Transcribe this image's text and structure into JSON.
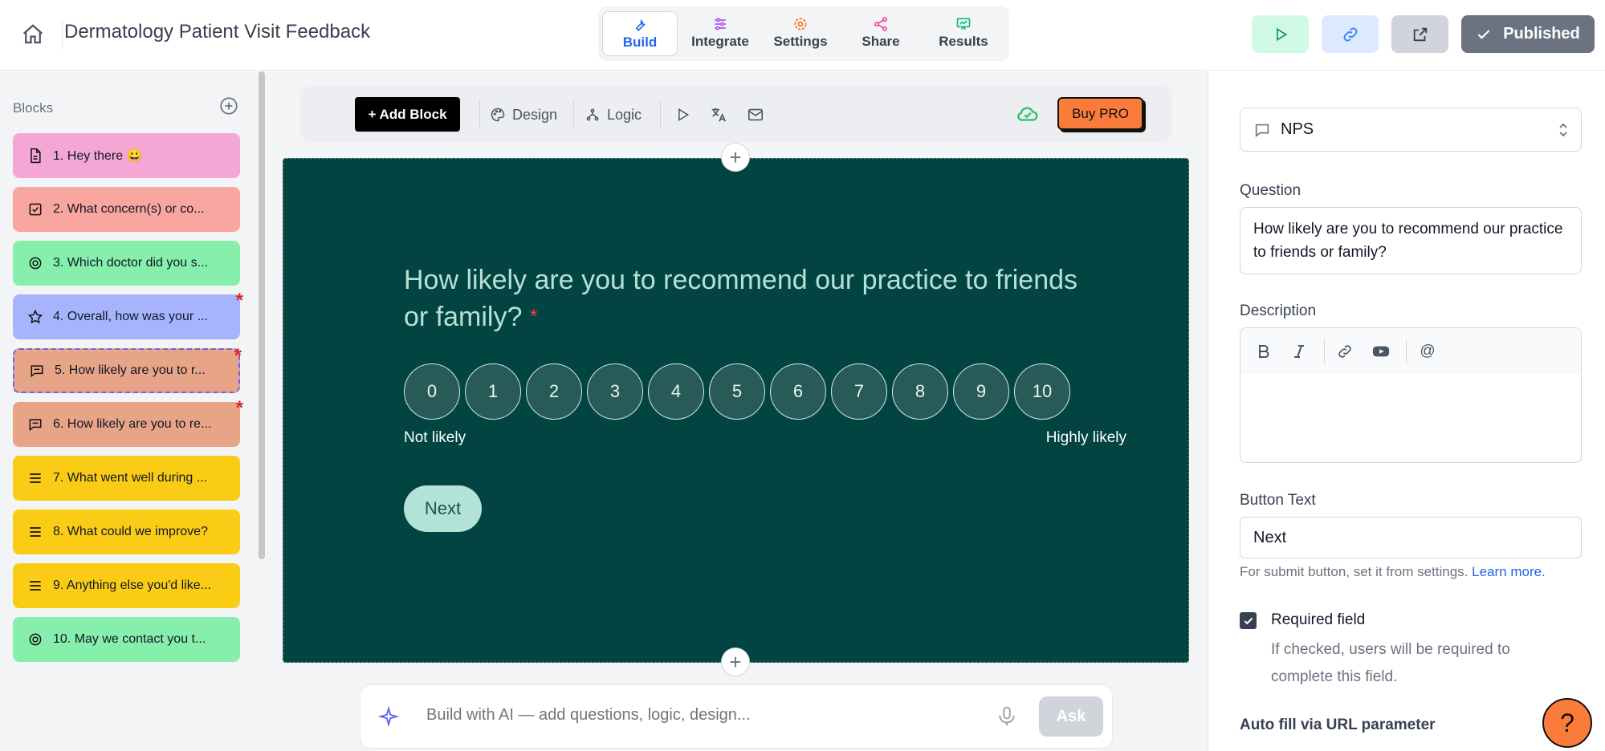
{
  "app": {
    "title": "Dermatology Patient Visit Feedback"
  },
  "tabs": [
    {
      "label": "Build",
      "active": true
    },
    {
      "label": "Integrate",
      "active": false
    },
    {
      "label": "Settings",
      "active": false
    },
    {
      "label": "Share",
      "active": false
    },
    {
      "label": "Results",
      "active": false
    }
  ],
  "topActions": {
    "published_label": "Published"
  },
  "sidebar": {
    "title": "Blocks",
    "blocks": [
      {
        "label": "1. Hey there 😀",
        "color": "#f4a7d4",
        "icon": "document-icon",
        "required": false
      },
      {
        "label": "2. What concern(s) or co...",
        "color": "#f9a5a0",
        "icon": "checkbox-icon",
        "required": false
      },
      {
        "label": "3. Which doctor did you s...",
        "color": "#86efac",
        "icon": "radio-icon",
        "required": false
      },
      {
        "label": "4. Overall, how was your ...",
        "color": "#a5b4fc",
        "icon": "star-icon",
        "required": true
      },
      {
        "label": "5. How likely are you to r...",
        "color": "#e8a487",
        "icon": "chat-icon",
        "required": true,
        "selected": true
      },
      {
        "label": "6. How likely are you to re...",
        "color": "#e8a487",
        "icon": "chat-icon",
        "required": true
      },
      {
        "label": "7. What went well during ...",
        "color": "#facc15",
        "icon": "lines-icon",
        "required": false
      },
      {
        "label": "8. What could we improve?",
        "color": "#facc15",
        "icon": "lines-icon",
        "required": false
      },
      {
        "label": "9. Anything else you'd like...",
        "color": "#facc15",
        "icon": "lines-icon",
        "required": false
      },
      {
        "label": "10. May we contact you t...",
        "color": "#86efac",
        "icon": "radio-icon",
        "required": false
      }
    ]
  },
  "toolbar": {
    "add_block": "+ Add Block",
    "design": "Design",
    "logic": "Logic",
    "buy_pro": "Buy PRO"
  },
  "form": {
    "question": "How likely are you to recommend our practice to friends or family?",
    "required_mark": "*",
    "scale": [
      "0",
      "1",
      "2",
      "3",
      "4",
      "5",
      "6",
      "7",
      "8",
      "9",
      "10"
    ],
    "low_label": "Not likely",
    "high_label": "Highly likely",
    "next_label": "Next",
    "background": "#024442"
  },
  "ai": {
    "placeholder": "Build with AI — add questions, logic, design...",
    "ask_label": "Ask"
  },
  "panel": {
    "type_value": "NPS",
    "question_label": "Question",
    "question_value": "How likely are you to recommend our practice to friends or family?",
    "description_label": "Description",
    "button_text_label": "Button Text",
    "button_text_value": "Next",
    "hint_text": "For submit button, set it from settings.",
    "hint_link": "Learn more.",
    "required_label": "Required field",
    "required_desc": "If checked, users will be required to complete this field.",
    "required_checked": true,
    "autofill_label": "Auto fill via URL parameter"
  },
  "help": {
    "label": "?"
  }
}
